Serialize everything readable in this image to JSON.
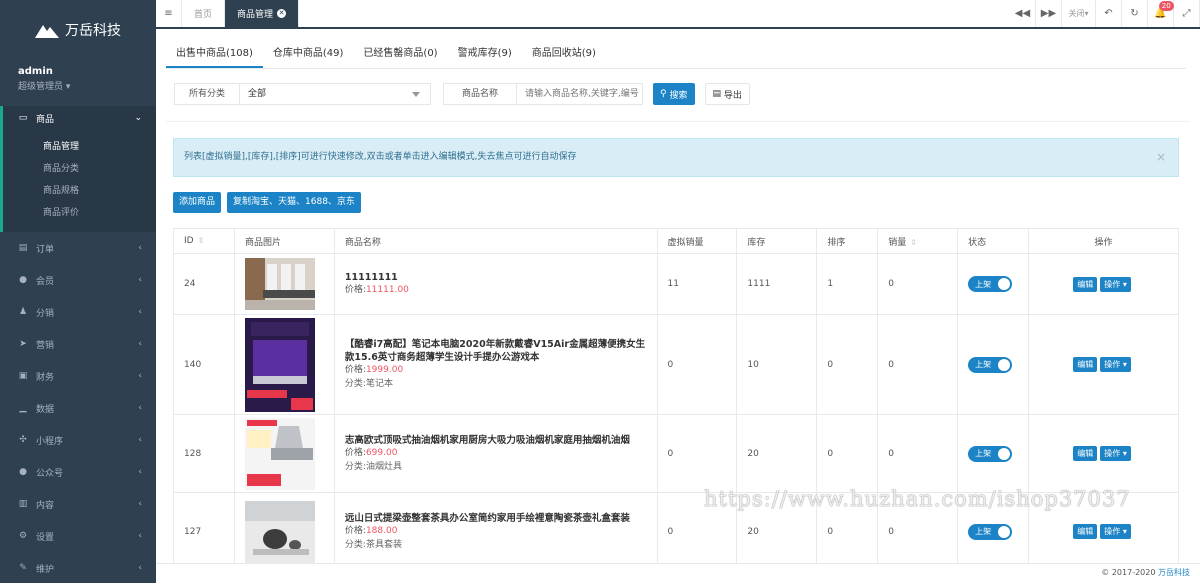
{
  "brand": {
    "name": "万岳科技"
  },
  "user": {
    "name": "admin",
    "role": "超级管理员"
  },
  "sidebar": {
    "active": {
      "label": "商品"
    },
    "sub": [
      "商品管理",
      "商品分类",
      "商品规格",
      "商品评价"
    ],
    "items": [
      {
        "label": "订单",
        "icon": "order-icon"
      },
      {
        "label": "会员",
        "icon": "user-icon"
      },
      {
        "label": "分销",
        "icon": "share-icon"
      },
      {
        "label": "营销",
        "icon": "send-icon"
      },
      {
        "label": "财务",
        "icon": "money-icon"
      },
      {
        "label": "数据",
        "icon": "chart-icon"
      },
      {
        "label": "小程序",
        "icon": "miniapp-icon"
      },
      {
        "label": "公众号",
        "icon": "wechat-icon"
      },
      {
        "label": "内容",
        "icon": "content-icon"
      },
      {
        "label": "设置",
        "icon": "gear-icon"
      },
      {
        "label": "维护",
        "icon": "tools-icon"
      }
    ]
  },
  "topbar": {
    "tabs": [
      "首页",
      "商品管理"
    ],
    "close_label": "关闭",
    "notice_count": "20"
  },
  "subtabs": [
    "出售中商品(108)",
    "仓库中商品(49)",
    "已经售罄商品(0)",
    "警戒库存(9)",
    "商品回收站(9)"
  ],
  "filter": {
    "category_label": "所有分类",
    "category_value": "全部",
    "name_label": "商品名称",
    "name_placeholder": "请输入商品名称,关键字,编号",
    "search_label": "搜索",
    "export_label": "导出"
  },
  "alert": {
    "text": "列表[虚拟销量],[库存],[排序]可进行快速修改,双击或者单击进入编辑模式,失去焦点可进行自动保存",
    "close": "×"
  },
  "actions": {
    "add": "添加商品",
    "copy": "复制淘宝、天猫、1688、京东"
  },
  "table": {
    "headers": [
      "ID",
      "商品图片",
      "商品名称",
      "虚拟销量",
      "库存",
      "排序",
      "销量",
      "状态",
      "操作"
    ],
    "status_label": "上架",
    "edit_label": "编辑",
    "op_label": "操作",
    "rows": [
      {
        "id": "24",
        "name": "11111111",
        "price_label": "价格:",
        "price": "11111.00",
        "category": "",
        "virtual": "11",
        "stock": "1111",
        "sort": "1",
        "sales": "0"
      },
      {
        "id": "140",
        "name": "【酷睿i7高配】笔记本电脑2020年新款戴睿V15Air金属超薄便携女生款15.6英寸商务超薄学生设计手提办公游戏本",
        "price_label": "价格:",
        "price": "1999.00",
        "category": "分类:笔记本",
        "virtual": "0",
        "stock": "10",
        "sort": "0",
        "sales": "0"
      },
      {
        "id": "128",
        "name": "志高欧式顶吸式抽油烟机家用厨房大吸力吸油烟机家庭用抽烟机油烟",
        "price_label": "价格:",
        "price": "699.00",
        "category": "分类:油烟灶具",
        "virtual": "0",
        "stock": "20",
        "sort": "0",
        "sales": "0"
      },
      {
        "id": "127",
        "name": "远山日式提梁壶整套茶具办公室简约家用手绘裡意陶瓷茶壶礼盒套装",
        "price_label": "价格:",
        "price": "188.00",
        "category": "分类:茶具套装",
        "virtual": "0",
        "stock": "20",
        "sort": "0",
        "sales": "0"
      }
    ]
  },
  "footer": {
    "copy": "© 2017-2020",
    "brand": "万岳科技"
  },
  "watermark": "https://www.huzhan.com/ishop37037",
  "colors": {
    "sidebar": "#2f4050",
    "accent": "#1c84c6",
    "green": "#19aa8d",
    "price": "#ed5565"
  }
}
